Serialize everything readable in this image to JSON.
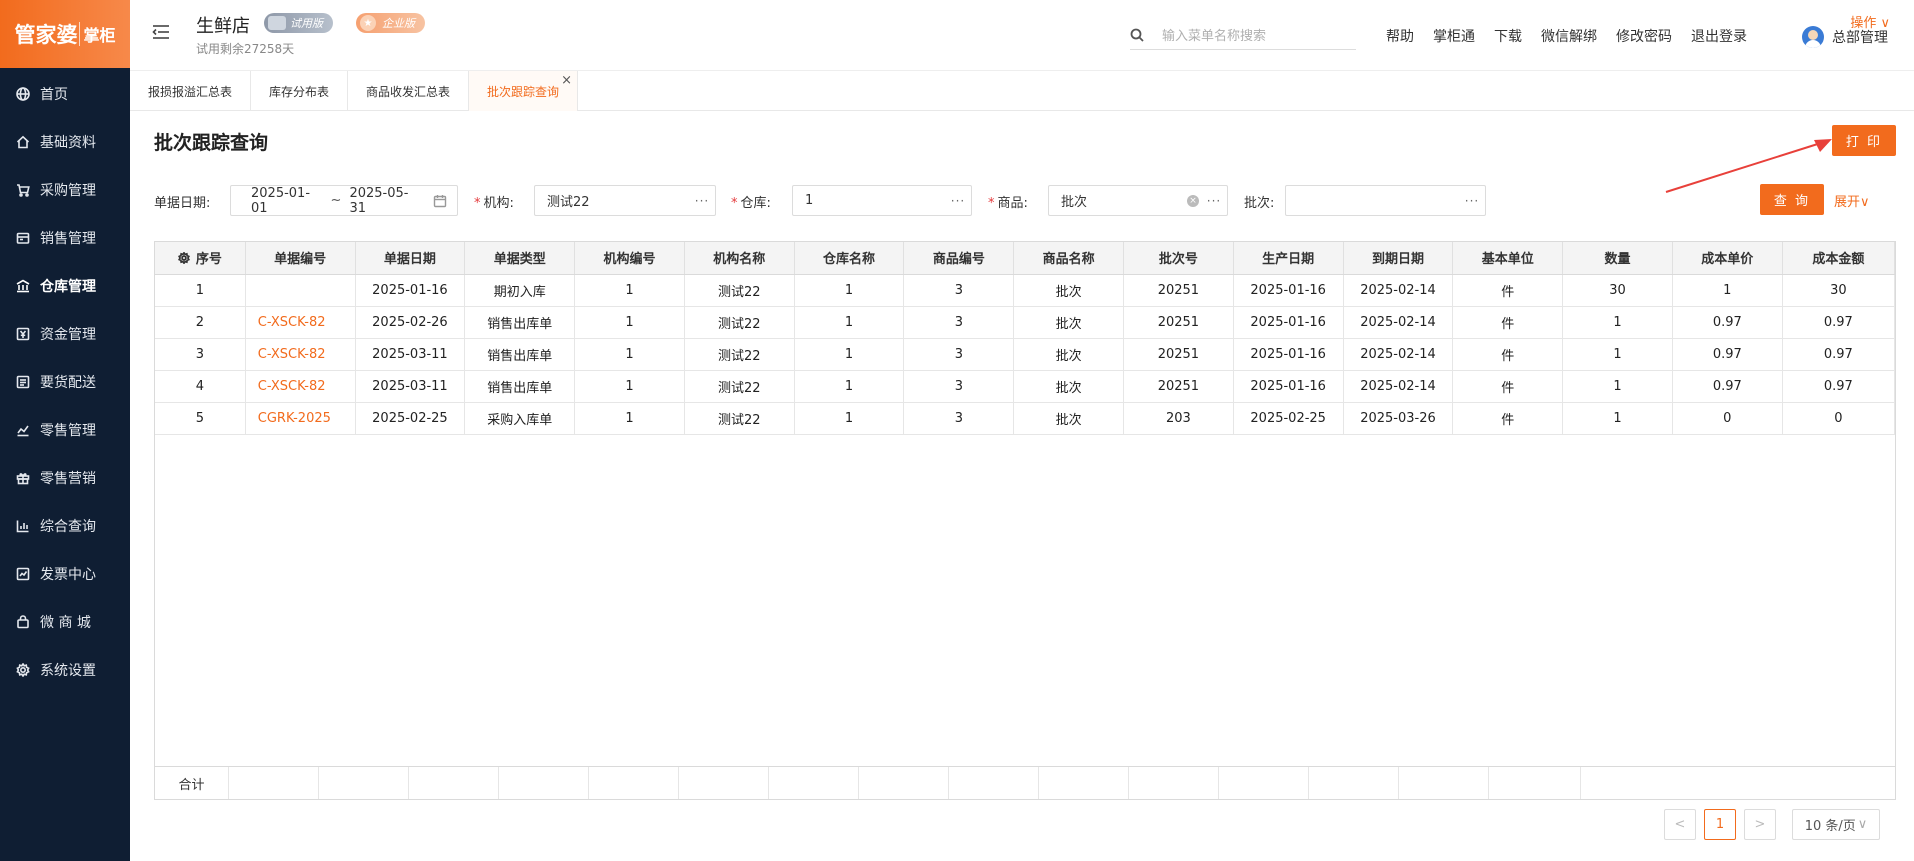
{
  "logo": {
    "main": "管家婆",
    "sub": "掌柜"
  },
  "sidebar": {
    "items": [
      {
        "label": "首页",
        "icon": "globe-icon"
      },
      {
        "label": "基础资料",
        "icon": "home-icon"
      },
      {
        "label": "采购管理",
        "icon": "cart-icon"
      },
      {
        "label": "销售管理",
        "icon": "sales-icon"
      },
      {
        "label": "仓库管理",
        "icon": "warehouse-icon",
        "active": true
      },
      {
        "label": "资金管理",
        "icon": "money-icon"
      },
      {
        "label": "要货配送",
        "icon": "delivery-icon"
      },
      {
        "label": "零售管理",
        "icon": "retail-icon"
      },
      {
        "label": "零售营销",
        "icon": "gift-icon"
      },
      {
        "label": "综合查询",
        "icon": "chart-icon"
      },
      {
        "label": "发票中心",
        "icon": "invoice-icon"
      },
      {
        "label": "微 商 城",
        "icon": "bag-icon"
      },
      {
        "label": "系统设置",
        "icon": "gear-icon"
      }
    ]
  },
  "header": {
    "store_name": "生鲜店",
    "trial_badge": "试用版",
    "ent_badge": "企业版",
    "trial_days": "试用剩余27258天",
    "search_placeholder": "输入菜单名称搜索",
    "links": [
      "帮助",
      "掌柜通",
      "下载",
      "微信解绑",
      "修改密码",
      "退出登录"
    ],
    "user": "总部管理"
  },
  "tabs": {
    "items": [
      "报损报溢汇总表",
      "库存分布表",
      "商品收发汇总表",
      "批次跟踪查询"
    ],
    "active_index": 3,
    "ops_label": "操作"
  },
  "page": {
    "title": "批次跟踪查询",
    "print_label": "打 印"
  },
  "filters": {
    "date_label": "单据日期:",
    "date_start": "2025-01-01",
    "date_sep": "~",
    "date_end": "2025-05-31",
    "org_label": "机构:",
    "org_value": "测试22",
    "wh_label": "仓库:",
    "wh_value": "1",
    "goods_label": "商品:",
    "goods_value": "批次",
    "batch_label": "批次:",
    "batch_value": "",
    "query_label": "查 询",
    "expand_label": "展开"
  },
  "table": {
    "columns": [
      "序号",
      "单据编号",
      "单据日期",
      "单据类型",
      "机构编号",
      "机构名称",
      "仓库名称",
      "商品编号",
      "商品名称",
      "批次号",
      "生产日期",
      "到期日期",
      "基本单位",
      "数量",
      "成本单价",
      "成本金额"
    ],
    "rows": [
      [
        "1",
        "",
        "2025-01-16",
        "期初入库",
        "1",
        "测试22",
        "1",
        "3",
        "批次",
        "20251",
        "2025-01-16",
        "2025-02-14",
        "件",
        "30",
        "1",
        "30"
      ],
      [
        "2",
        "C-XSCK-82",
        "2025-02-26",
        "销售出库单",
        "1",
        "测试22",
        "1",
        "3",
        "批次",
        "20251",
        "2025-01-16",
        "2025-02-14",
        "件",
        "1",
        "0.97",
        "0.97"
      ],
      [
        "3",
        "C-XSCK-82",
        "2025-03-11",
        "销售出库单",
        "1",
        "测试22",
        "1",
        "3",
        "批次",
        "20251",
        "2025-01-16",
        "2025-02-14",
        "件",
        "1",
        "0.97",
        "0.97"
      ],
      [
        "4",
        "C-XSCK-82",
        "2025-03-11",
        "销售出库单",
        "1",
        "测试22",
        "1",
        "3",
        "批次",
        "20251",
        "2025-01-16",
        "2025-02-14",
        "件",
        "1",
        "0.97",
        "0.97"
      ],
      [
        "5",
        "CGRK-2025",
        "2025-02-25",
        "采购入库单",
        "1",
        "测试22",
        "1",
        "3",
        "批次",
        "203",
        "2025-02-25",
        "2025-03-26",
        "件",
        "1",
        "0",
        "0"
      ]
    ],
    "total_label": "合计"
  },
  "pagination": {
    "prev": "<",
    "current": "1",
    "next": ">",
    "page_size": "10 条/页"
  },
  "colors": {
    "accent": "#f26b1d",
    "sidebar_bg": "#0f1e33"
  }
}
